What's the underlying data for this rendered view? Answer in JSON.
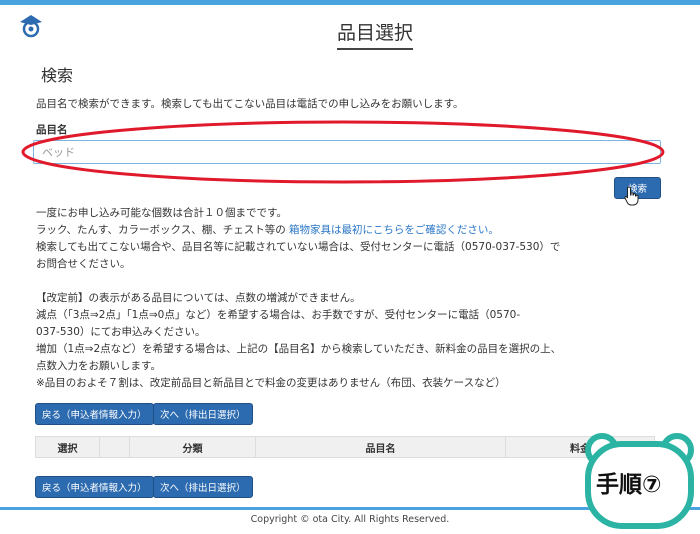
{
  "header": {
    "page_title": "品目選択"
  },
  "search": {
    "heading": "検索",
    "description": "品目名で検索ができます。検索しても出てこない品目は電話での申し込みをお願いします。",
    "field_label": "品目名",
    "placeholder": "ベッド",
    "value": "",
    "button_label": "検索"
  },
  "info": {
    "line1": "一度にお申し込み可能な個数は合計１０個までです。",
    "line2_prefix": "ラック、たんす、カラーボックス、棚、チェスト等の ",
    "line2_link": "箱物家具は最初にこちらをご確認ください。",
    "line3": "検索しても出てこない場合や、品目名等に記載されていない場合は、受付センターに電話（0570-037-530）で",
    "line4": "お問合せください。"
  },
  "notes": {
    "line1": "【改定前】の表示がある品目については、点数の増減ができません。",
    "line2": "減点（「3点⇒2点」「1点⇒0点」など）を希望する場合は、お手数ですが、受付センターに電話（0570-",
    "line3": "037-530）にてお申込みください。",
    "line4": "増加（1点⇒2点など）を希望する場合は、上記の【品目名】から検索していただき、新料金の品目を選択の上、",
    "line5": "点数入力をお願いします。",
    "line6": "※品目のおよそ７割は、改定前品目と新品目とで料金の変更はありません（布団、衣装ケースなど）"
  },
  "nav": {
    "back_label": "戻る（申込者情報入力）",
    "next_label": "次へ（排出日選択）"
  },
  "table": {
    "columns": [
      "選択",
      "",
      "分類",
      "品目名",
      "料金"
    ]
  },
  "footer": {
    "copyright": "Copyright © ota City. All Rights Reserved."
  },
  "overlay": {
    "step_label": "手順⑦"
  },
  "colors": {
    "accent": "#4aa3df",
    "button": "#2c6bb0",
    "link": "#2a76c6",
    "annotation_red": "#e0192b",
    "badge_border": "#2bb3a3"
  }
}
